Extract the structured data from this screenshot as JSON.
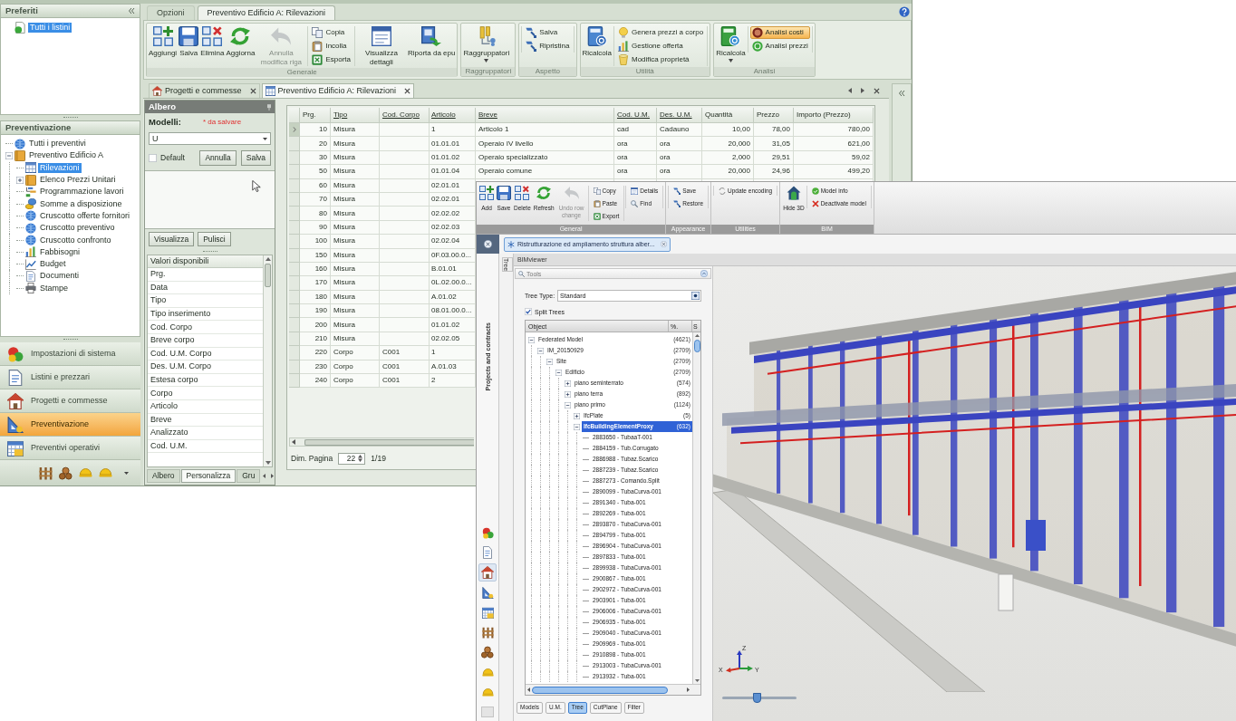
{
  "back_window": {
    "favorites": {
      "title": "Preferiti",
      "items": [
        {
          "label": "Tutti i listini",
          "selected": true
        }
      ]
    },
    "estimates": {
      "title": "Preventivazione",
      "tree": [
        {
          "label": "Tutti i preventivi",
          "selected": false
        },
        {
          "label": "Preventivo Edificio A",
          "selected": false,
          "expanded": true,
          "children": [
            {
              "label": "Rilevazioni",
              "selected": true
            },
            {
              "label": "Elenco Prezzi Unitari",
              "selected": false,
              "expanded": false
            },
            {
              "label": "Programmazione lavori",
              "selected": false
            },
            {
              "label": "Somme a disposizione",
              "selected": false
            },
            {
              "label": "Cruscotto offerte fornitori",
              "selected": false
            },
            {
              "label": "Cruscotto preventivo",
              "selected": false
            },
            {
              "label": "Cruscotto confronto",
              "selected": false
            },
            {
              "label": "Fabbisogni",
              "selected": false
            },
            {
              "label": "Budget",
              "selected": false
            },
            {
              "label": "Documenti",
              "selected": false
            },
            {
              "label": "Stampe",
              "selected": false
            }
          ]
        }
      ]
    },
    "nav": [
      {
        "label": "Impostazioni di sistema",
        "selected": false
      },
      {
        "label": "Listini e prezzari",
        "selected": false
      },
      {
        "label": "Progetti e commesse",
        "selected": false
      },
      {
        "label": "Preventivazione",
        "selected": true
      },
      {
        "label": "Preventivi operativi",
        "selected": false
      }
    ],
    "ribbon": {
      "tabs": [
        {
          "label": "Opzioni",
          "selected": false
        },
        {
          "label": "Preventivo Edificio A: Rilevazioni",
          "selected": true
        }
      ],
      "groups": [
        {
          "label": "Generale",
          "items": [
            {
              "kind": "large",
              "label": "Aggiungi",
              "disabled": false
            },
            {
              "kind": "large",
              "label": "Salva",
              "disabled": false
            },
            {
              "kind": "large",
              "label": "Elimina",
              "disabled": false
            },
            {
              "kind": "large",
              "label": "Aggiorna",
              "disabled": false
            },
            {
              "kind": "large",
              "label": "Annulla modifica riga",
              "disabled": true
            },
            {
              "kind": "stack",
              "items": [
                {
                  "label": "Copia",
                  "active": false
                },
                {
                  "label": "Incolla",
                  "active": false
                },
                {
                  "label": "Esporta",
                  "active": false
                }
              ]
            },
            {
              "kind": "large",
              "label": "Visualizza dettagli",
              "disabled": false
            },
            {
              "kind": "large",
              "label": "Riporta da epu",
              "disabled": false
            }
          ]
        },
        {
          "label": "Raggruppatori",
          "items": [
            {
              "kind": "large",
              "label": "Raggruppatori",
              "disabled": false,
              "dropdown": true
            }
          ]
        },
        {
          "label": "Aspetto",
          "items": [
            {
              "kind": "stack",
              "items": [
                {
                  "label": "Salva",
                  "active": false
                },
                {
                  "label": "Ripristina",
                  "active": false
                }
              ]
            }
          ]
        },
        {
          "label": "Utilità",
          "items": [
            {
              "kind": "large",
              "label": "Ricalcola",
              "disabled": false
            },
            {
              "kind": "stack",
              "items": [
                {
                  "label": "Genera prezzi a corpo",
                  "active": false
                },
                {
                  "label": "Gestione offerta",
                  "active": false
                },
                {
                  "label": "Modifica proprietà",
                  "active": false
                }
              ]
            }
          ]
        },
        {
          "label": "Analisi",
          "items": [
            {
              "kind": "large",
              "label": "Ricalcola",
              "disabled": false,
              "dropdown": true
            },
            {
              "kind": "stack",
              "items": [
                {
                  "label": "Analisi costi",
                  "active": true
                },
                {
                  "label": "Analisi prezzi",
                  "active": false
                }
              ]
            }
          ]
        }
      ]
    },
    "document_tabs": [
      {
        "label": "Progetti e commesse",
        "selected": false
      },
      {
        "label": "Preventivo Edificio A: Rilevazioni",
        "selected": true
      }
    ],
    "tree_panel": {
      "title": "Albero",
      "models_label": "Modelli:",
      "unsaved_note": "* da salvare",
      "model": "U",
      "default_checkbox": {
        "label": "Default",
        "checked": false
      },
      "buttons": [
        "Annulla",
        "Salva"
      ],
      "view_buttons": [
        "Visualizza",
        "Pulisci"
      ],
      "values_header": "Valori disponibili",
      "values": [
        "Prg.",
        "Data",
        "Tipo",
        "Tipo inserimento",
        "Cod. Corpo",
        "Breve corpo",
        "Cod. U.M. Corpo",
        "Des. U.M. Corpo",
        "Estesa corpo",
        "Corpo",
        "Articolo",
        "Breve",
        "Analizzato",
        "Cod. U.M."
      ],
      "tabs": [
        {
          "label": "Albero",
          "selected": false
        },
        {
          "label": "Personalizza",
          "selected": true
        },
        {
          "label": "Gru",
          "selected": false
        }
      ]
    },
    "table": {
      "columns": [
        {
          "label": "Prg.",
          "underlined": false
        },
        {
          "label": "Tipo",
          "underlined": true
        },
        {
          "label": "Cod. Corpo",
          "underlined": true
        },
        {
          "label": "Articolo",
          "underlined": true
        },
        {
          "label": "Breve",
          "underlined": true
        },
        {
          "label": "Cod. U.M.",
          "underlined": true
        },
        {
          "label": "Des. U.M.",
          "underlined": true
        },
        {
          "label": "Quantità",
          "underlined": false
        },
        {
          "label": "Prezzo",
          "underlined": false
        },
        {
          "label": "Importo (Prezzo)",
          "underlined": false
        }
      ],
      "rows": [
        {
          "prg": "10",
          "tipo": "Misura",
          "articolo": "1",
          "breve": "Articolo 1",
          "cod_um": "cad",
          "des_um": "Cadauno",
          "quantita": "10,00",
          "prezzo": "78,00",
          "importo": "780,00",
          "current": true
        },
        {
          "prg": "20",
          "tipo": "Misura",
          "articolo": "01.01.01",
          "breve": "Operaio IV livello",
          "cod_um": "ora",
          "des_um": "ora",
          "quantita": "20,000",
          "prezzo": "31,05",
          "importo": "621,00",
          "current": false
        },
        {
          "prg": "30",
          "tipo": "Misura",
          "articolo": "01.01.02",
          "breve": "Operaio specializzato",
          "cod_um": "ora",
          "des_um": "ora",
          "quantita": "2,000",
          "prezzo": "29,51",
          "importo": "59,02",
          "current": false
        },
        {
          "prg": "50",
          "tipo": "Misura",
          "articolo": "01.01.04",
          "breve": "Operaio comune",
          "cod_um": "ora",
          "des_um": "ora",
          "quantita": "20,000",
          "prezzo": "24,96",
          "importo": "499,20",
          "current": false
        },
        {
          "prg": "60",
          "tipo": "Misura",
          "articolo": "02.01.01",
          "current": false
        },
        {
          "prg": "70",
          "tipo": "Misura",
          "articolo": "02.02.01",
          "current": false
        },
        {
          "prg": "80",
          "tipo": "Misura",
          "articolo": "02.02.02",
          "current": false
        },
        {
          "prg": "90",
          "tipo": "Misura",
          "articolo": "02.02.03",
          "current": false
        },
        {
          "prg": "100",
          "tipo": "Misura",
          "articolo": "02.02.04",
          "current": false
        },
        {
          "prg": "150",
          "tipo": "Misura",
          "articolo": "0F.03.00.0...",
          "current": false
        },
        {
          "prg": "160",
          "tipo": "Misura",
          "articolo": "B.01.01",
          "current": false
        },
        {
          "prg": "170",
          "tipo": "Misura",
          "articolo": "0L.02.00.0...",
          "current": false
        },
        {
          "prg": "180",
          "tipo": "Misura",
          "articolo": "A.01.02",
          "current": false
        },
        {
          "prg": "190",
          "tipo": "Misura",
          "articolo": "08.01.00.0...",
          "current": false
        },
        {
          "prg": "200",
          "tipo": "Misura",
          "articolo": "01.01.02",
          "current": false
        },
        {
          "prg": "210",
          "tipo": "Misura",
          "articolo": "02.02.05",
          "current": false
        },
        {
          "prg": "220",
          "tipo": "Corpo",
          "cod_corpo": "C001",
          "articolo": "1",
          "current": false
        },
        {
          "prg": "230",
          "tipo": "Corpo",
          "cod_corpo": "C001",
          "articolo": "A.01.03",
          "current": false
        },
        {
          "prg": "240",
          "tipo": "Corpo",
          "cod_corpo": "C001",
          "articolo": "2",
          "current": false
        }
      ],
      "page_size_label": "Dim. Pagina",
      "page_size": "22",
      "page": "1/19"
    }
  },
  "front_window": {
    "ribbon": {
      "groups": [
        {
          "label": "General",
          "items": [
            {
              "kind": "large",
              "label": "Add",
              "disabled": false
            },
            {
              "kind": "large",
              "label": "Save",
              "disabled": false
            },
            {
              "kind": "large",
              "label": "Delete",
              "disabled": false
            },
            {
              "kind": "large",
              "label": "Refresh",
              "disabled": false
            },
            {
              "kind": "large",
              "label": "Undo row change",
              "disabled": true
            },
            {
              "kind": "stack",
              "items": [
                {
                  "label": "Copy",
                  "active": false
                },
                {
                  "label": "Paste",
                  "active": false
                },
                {
                  "label": "Export",
                  "active": false
                }
              ]
            },
            {
              "kind": "stack",
              "items": [
                {
                  "label": "Details",
                  "active": false
                },
                {
                  "label": "Find",
                  "active": false
                }
              ]
            }
          ]
        },
        {
          "label": "Appearance",
          "items": [
            {
              "kind": "stack",
              "items": [
                {
                  "label": "Save",
                  "active": false
                },
                {
                  "label": "Restore",
                  "active": false
                }
              ]
            }
          ]
        },
        {
          "label": "Utilities",
          "items": [
            {
              "kind": "stack",
              "items": [
                {
                  "label": "Update encoding",
                  "active": false
                }
              ]
            }
          ]
        },
        {
          "label": "BIM",
          "items": [
            {
              "kind": "large",
              "label": "Hide 3D",
              "disabled": false
            },
            {
              "kind": "stack",
              "items": [
                {
                  "label": "Model info",
                  "active": false
                },
                {
                  "label": "Deactivate model",
                  "active": false
                }
              ]
            }
          ]
        }
      ]
    },
    "document_tab": {
      "label": "Ristrutturazione ed ampliamento struttura alber..."
    },
    "side_panel": {
      "title": "Projects and contracts",
      "items": [
        {
          "selected": false
        },
        {
          "selected": false
        },
        {
          "selected": true
        },
        {
          "selected": false
        },
        {
          "selected": false
        },
        {
          "selected": false
        },
        {
          "selected": false
        },
        {
          "selected": false
        },
        {
          "selected": false
        }
      ]
    },
    "side_tab": "Tree",
    "viewer": {
      "title": "BIMviewer",
      "tools": {
        "title": "Tools",
        "tree_type_label": "Tree Type:",
        "tree_type": "Standard",
        "split_trees": {
          "label": "Split Trees",
          "checked": true
        },
        "columns": [
          "Object",
          "%.",
          "S"
        ],
        "tree": [
          {
            "label": "Federated Model",
            "count": "(4621)",
            "selected": false,
            "expanded": true,
            "children": [
              {
                "label": "IM_20150929",
                "count": "(2709)",
                "selected": false,
                "expanded": true,
                "children": [
                  {
                    "label": "Site",
                    "count": "(2709)",
                    "selected": false,
                    "expanded": true,
                    "children": [
                      {
                        "label": "Edificio",
                        "count": "(2709)",
                        "selected": false,
                        "expanded": true,
                        "children": [
                          {
                            "label": "piano seminterrato",
                            "count": "(574)",
                            "selected": false,
                            "expanded": false
                          },
                          {
                            "label": "piano terra",
                            "count": "(892)",
                            "selected": false,
                            "expanded": false
                          },
                          {
                            "label": "piano primo",
                            "count": "(1124)",
                            "selected": false,
                            "expanded": true,
                            "children": [
                              {
                                "label": "IfcPlate",
                                "count": "(5)",
                                "selected": false,
                                "expanded": false
                              },
                              {
                                "label": "IfcBuildingElementProxy",
                                "count": "(632)",
                                "selected": true,
                                "expanded": true,
                                "children": [
                                  {
                                    "label": "2883650 - TubaaT-001",
                                    "selected": false
                                  },
                                  {
                                    "label": "2884159 - Tub.Corrugato",
                                    "selected": false
                                  },
                                  {
                                    "label": "2886988 - Tubaz.Scarico",
                                    "selected": false
                                  },
                                  {
                                    "label": "2887239 - Tubaz.Scarico",
                                    "selected": false
                                  },
                                  {
                                    "label": "2887273 - Comando.Split",
                                    "selected": false
                                  },
                                  {
                                    "label": "2890099 - TubaCurva-001",
                                    "selected": false
                                  },
                                  {
                                    "label": "2891340 - Tuba-001",
                                    "selected": false
                                  },
                                  {
                                    "label": "2892269 - Tuba-001",
                                    "selected": false
                                  },
                                  {
                                    "label": "2893870 - TubaCurva-001",
                                    "selected": false
                                  },
                                  {
                                    "label": "2894799 - Tuba-001",
                                    "selected": false
                                  },
                                  {
                                    "label": "2896904 - TubaCurva-001",
                                    "selected": false
                                  },
                                  {
                                    "label": "2897833 - Tuba-001",
                                    "selected": false
                                  },
                                  {
                                    "label": "2899938 - TubaCurva-001",
                                    "selected": false
                                  },
                                  {
                                    "label": "2900867 - Tuba-001",
                                    "selected": false
                                  },
                                  {
                                    "label": "2902972 - TubaCurva-001",
                                    "selected": false
                                  },
                                  {
                                    "label": "2903901 - Tuba-001",
                                    "selected": false
                                  },
                                  {
                                    "label": "2906006 - TubaCurva-001",
                                    "selected": false
                                  },
                                  {
                                    "label": "2906935 - Tuba-001",
                                    "selected": false
                                  },
                                  {
                                    "label": "2909040 - TubaCurva-001",
                                    "selected": false
                                  },
                                  {
                                    "label": "2909969 - Tuba-001",
                                    "selected": false
                                  },
                                  {
                                    "label": "2910898 - Tuba-001",
                                    "selected": false
                                  },
                                  {
                                    "label": "2913003 - TubaCurva-001",
                                    "selected": false
                                  },
                                  {
                                    "label": "2913932 - Tuba-001",
                                    "selected": false
                                  }
                                ]
                              }
                            ]
                          }
                        ]
                      }
                    ]
                  }
                ]
              }
            ]
          }
        ],
        "tabs": [
          {
            "label": "Models",
            "selected": false
          },
          {
            "label": "U.M.",
            "selected": false
          },
          {
            "label": "Tree",
            "selected": true
          },
          {
            "label": "CutPlane",
            "selected": false
          },
          {
            "label": "Filter",
            "selected": false
          }
        ]
      },
      "axes": [
        "Z",
        "X",
        "Y"
      ],
      "zoom_slider": {
        "level": 0.46
      }
    }
  }
}
